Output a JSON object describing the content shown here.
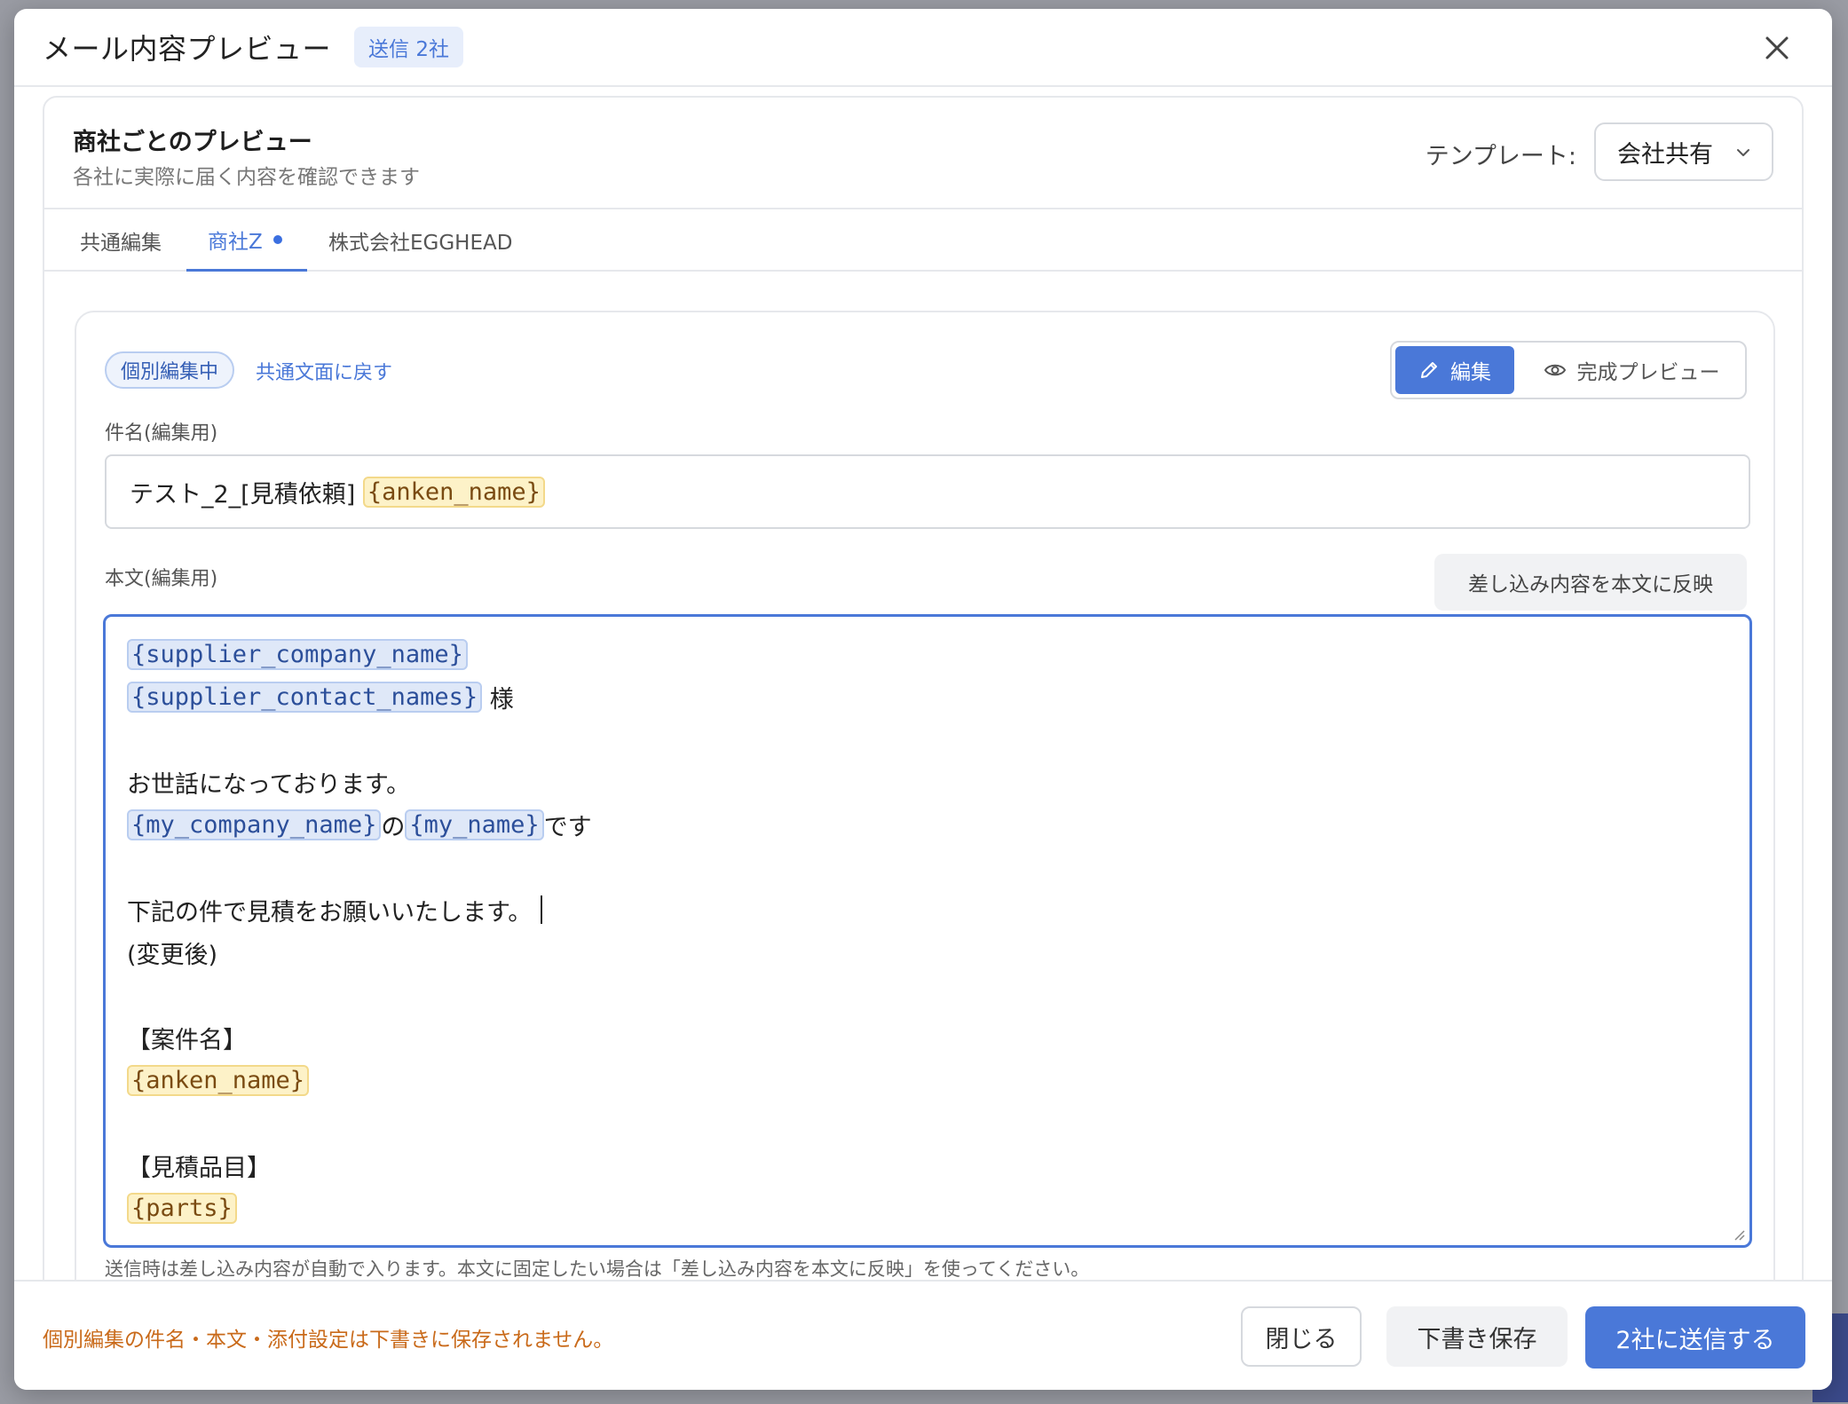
{
  "header": {
    "title": "メール内容プレビュー",
    "send_badge": "送信 2社"
  },
  "card": {
    "title": "商社ごとのプレビュー",
    "subtitle": "各社に実際に届く内容を確認できます",
    "template_label": "テンプレート:",
    "template_value": "会社共有"
  },
  "tabs": [
    {
      "label": "共通編集",
      "active": false
    },
    {
      "label": "商社Z",
      "active": true,
      "modified": true
    },
    {
      "label": "株式会社EGGHEAD",
      "active": false
    }
  ],
  "editor": {
    "editing_badge": "個別編集中",
    "revert_link": "共通文面に戻す",
    "mode_edit": "編集",
    "mode_preview": "完成プレビュー",
    "subject_label": "件名(編集用)",
    "subject_text": "テスト_2_[見積依頼] ",
    "subject_placeholder": "{anken_name}",
    "body_label": "本文(編集用)",
    "reflect_button": "差し込み内容を本文に反映",
    "body": {
      "l1_ph": "{supplier_company_name}",
      "l2_ph": "{supplier_contact_names}",
      "l2_text": " 様",
      "l4_text": "お世話になっております。",
      "l5_ph1": "{my_company_name}",
      "l5_mid": "の",
      "l5_ph2": "{my_name}",
      "l5_end": "です",
      "l7_text": "下記の件で見積をお願いいたします。",
      "l8_text": "(変更後)",
      "l10_text": "【案件名】",
      "l11_ph": "{anken_name}",
      "l13_text": "【見積品目】",
      "l14_ph": "{parts}"
    },
    "hint": "送信時は差し込み内容が自動で入ります。本文に固定したい場合は「差し込み内容を本文に反映」を使ってください。"
  },
  "footer": {
    "warning": "個別編集の件名・本文・添付設定は下書きに保存されません。",
    "close": "閉じる",
    "save_draft": "下書き保存",
    "send": "2社に送信する"
  },
  "colors": {
    "accent": "#4a78d8",
    "warning": "#c96a1a",
    "placeholder_yellow_bg": "#fdf2c8",
    "placeholder_blue_bg": "#dfe8f8"
  },
  "icons": [
    "close-icon",
    "chevron-down-icon",
    "pencil-icon",
    "eye-icon",
    "resize-grip-icon"
  ]
}
